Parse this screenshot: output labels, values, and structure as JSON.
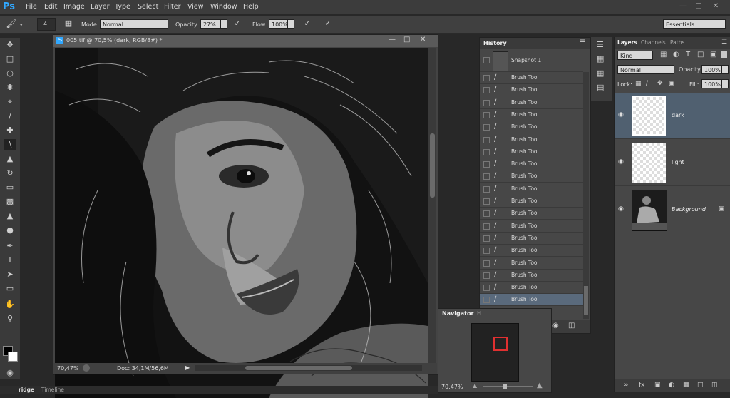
{
  "app": {
    "logo": "Ps",
    "workspace": "Essentials"
  },
  "menu": [
    "File",
    "Edit",
    "Image",
    "Layer",
    "Type",
    "Select",
    "Filter",
    "View",
    "Window",
    "Help"
  ],
  "options": {
    "brush_size": "4",
    "mode_label": "Mode:",
    "mode_value": "Normal",
    "opacity_label": "Opacity:",
    "opacity_value": "27%",
    "flow_label": "Flow:",
    "flow_value": "100%"
  },
  "document": {
    "tab_title": "005.tif @ 70,5% (dark, RGB/8#) *",
    "zoom": "70,47%",
    "doc_info": "Doc: 34,1M/56,6M"
  },
  "history": {
    "title": "History",
    "snapshot": "Snapshot 1",
    "items": [
      "Brush Tool",
      "Brush Tool",
      "Brush Tool",
      "Brush Tool",
      "Brush Tool",
      "Brush Tool",
      "Brush Tool",
      "Brush Tool",
      "Brush Tool",
      "Brush Tool",
      "Brush Tool",
      "Brush Tool",
      "Brush Tool",
      "Brush Tool",
      "Brush Tool",
      "Brush Tool",
      "Brush Tool",
      "Brush Tool",
      "Brush Tool"
    ]
  },
  "navigator": {
    "title": "Navigator",
    "tab2": "H",
    "zoom": "70,47%"
  },
  "layers": {
    "tabs": [
      "Layers",
      "Channels",
      "Paths"
    ],
    "kind": "Kind",
    "blend_mode": "Normal",
    "opacity_label": "Opacity:",
    "opacity_value": "100%",
    "lock_label": "Lock:",
    "fill_label": "Fill:",
    "fill_value": "100%",
    "items": [
      {
        "name": "dark"
      },
      {
        "name": "light"
      },
      {
        "name": "Background"
      }
    ]
  },
  "bottom_tabs": [
    "ridge",
    "Timeline"
  ],
  "colors": {
    "accent": "#31a8ff",
    "selected_layer": "#506070",
    "selected_history": "#5a6a7c"
  },
  "icons": [
    "brush-icon",
    "move-icon",
    "marquee-icon",
    "lasso-icon",
    "quick-select-icon",
    "crop-icon",
    "eyedropper-icon",
    "healing-icon",
    "brush-tool-icon",
    "stamp-icon",
    "history-brush-icon",
    "eraser-icon",
    "gradient-icon",
    "blur-icon",
    "dodge-icon",
    "pen-icon",
    "type-icon",
    "path-select-icon",
    "shape-icon",
    "hand-icon",
    "zoom-icon",
    "eye-icon",
    "lock-icon"
  ]
}
